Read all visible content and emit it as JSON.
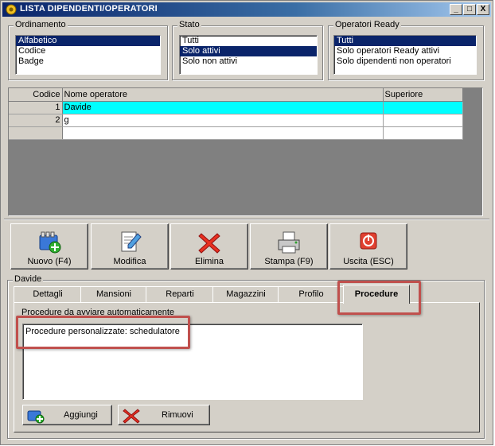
{
  "window": {
    "title": "LISTA DIPENDENTI/OPERATORI",
    "controls": [
      "_",
      "□",
      "X"
    ]
  },
  "ordinamento": {
    "label": "Ordinamento",
    "items": [
      "Alfabetico",
      "Codice",
      "Badge"
    ],
    "selected": "Alfabetico"
  },
  "stato": {
    "label": "Stato",
    "items": [
      "Tutti",
      "Solo attivi",
      "Solo non attivi"
    ],
    "selected": "Solo attivi"
  },
  "operatori_ready": {
    "label": "Operatori Ready",
    "items": [
      "Tutti",
      "Solo operatori Ready attivi",
      "Solo dipendenti non operatori"
    ],
    "selected": "Tutti"
  },
  "grid": {
    "headers": [
      "Codice",
      "Nome operatore",
      "Superiore"
    ],
    "rows": [
      {
        "codice": "1",
        "nome": "Davide",
        "superiore": ""
      },
      {
        "codice": "2",
        "nome": "g",
        "superiore": ""
      }
    ]
  },
  "toolbar": {
    "nuovo": "Nuovo (F4)",
    "modifica": "Modifica",
    "elimina": "Elimina",
    "stampa": "Stampa (F9)",
    "uscita": "Uscita (ESC)"
  },
  "detail": {
    "label": "Davide",
    "tabs": [
      "Dettagli",
      "Mansioni",
      "Reparti",
      "Magazzini",
      "Profilo",
      "Procedure"
    ],
    "active_tab": "Procedure",
    "section_label": "Procedure da avviare automaticamente",
    "procedures": [
      "Procedure personalizzate: schedulatore"
    ],
    "add_button": "Aggiungi",
    "remove_button": "Rimuovi"
  },
  "colors": {
    "accent_highlight": "#c0504d",
    "selection": "#0a246a",
    "active_row": "#00ffff"
  }
}
